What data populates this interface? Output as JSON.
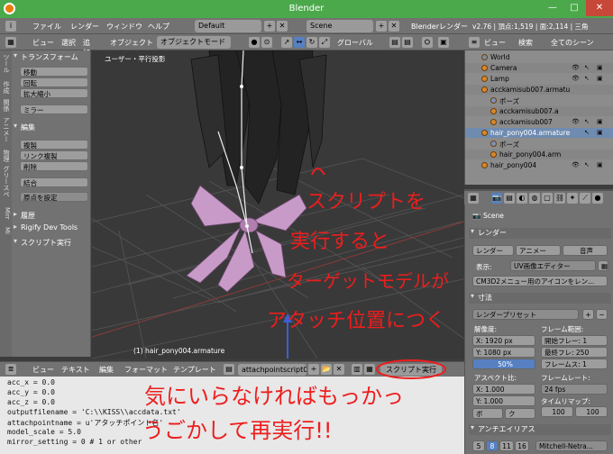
{
  "window": {
    "title": "Blender"
  },
  "topbar": {
    "menus": [
      "ファイル",
      "レンダー",
      "ウィンドウ",
      "ヘルプ"
    ],
    "layout": "Default",
    "scene": "Scene",
    "engine": "Blenderレンダー",
    "stats": "v2.76 | 頂点:1,519 | 面:2,114 | 三角"
  },
  "view3d_header": {
    "menus": [
      "ビュー",
      "選択",
      "追加",
      "オブジェクト"
    ],
    "mode": "オブジェクトモード",
    "orientation": "グローバル"
  },
  "toolshelf": {
    "tabs": [
      "ツール",
      "作成",
      "関係",
      "アニメー",
      "物理",
      "グリースペ",
      "Mirr",
      "Mi"
    ],
    "transform_header": "トランスフォーム",
    "transform_buttons": [
      "移動",
      "回転",
      "拡大縮小",
      "ミラー"
    ],
    "edit_header": "編集",
    "edit_buttons": [
      "複製",
      "リンク複製",
      "削除",
      "結合"
    ],
    "origin_label": "原点を設定",
    "history_header": "履歴",
    "rigify_header": "Rigify Dev Tools",
    "script_header": "スクリプト実行"
  },
  "viewport": {
    "label": "ユーザー・平行投影",
    "footer": "(1) hair_pony004.armature"
  },
  "outliner": {
    "menus": [
      "ビュー",
      "検索"
    ],
    "filter": "全てのシーン",
    "rows": [
      {
        "name": "World",
        "indent": 1
      },
      {
        "name": "Camera",
        "indent": 1
      },
      {
        "name": "Lamp",
        "indent": 1
      },
      {
        "name": "acckamisub007.armatu",
        "indent": 1
      },
      {
        "name": "ポーズ",
        "indent": 2
      },
      {
        "name": "acckamisub007.a",
        "indent": 2
      },
      {
        "name": "acckamisub007",
        "indent": 2
      },
      {
        "name": "hair_pony004.armature",
        "indent": 1
      },
      {
        "name": "ポーズ",
        "indent": 2
      },
      {
        "name": "hair_pony004.arm",
        "indent": 2
      },
      {
        "name": "hair_pony004",
        "indent": 2
      }
    ]
  },
  "properties": {
    "scene_label": "Scene",
    "render_header": "レンダー",
    "render_btn": "レンダー",
    "anim_btn": "アニメー",
    "audio_btn": "音声",
    "display_label": "表示:",
    "display_value": "UV画像エディター",
    "cm3d2_btn": "CM3D2メニュー用のアイコンをレン...",
    "dims_header": "寸法",
    "preset": "レンダープリセット",
    "resolution_label": "解像度:",
    "res_x": "X:  1920 px",
    "res_y": "Y:  1080 px",
    "res_pct": "50%",
    "frame_range_label": "フレーム範囲:",
    "frame_start": "開始フレー: 1",
    "frame_end": "最終フレ: 250",
    "frame_step": "フレームス: 1",
    "aspect_label": "アスペクト比:",
    "asp_x": "X:      1.000",
    "asp_y": "Y:      1.000",
    "framerate_label": "フレームレート:",
    "fps": "24 fps",
    "timemap_label": "タイムリマップ:",
    "timemap_old": "100",
    "timemap_new": "100",
    "border_label": "ボ",
    "crop_label": "ク",
    "aa_header": "アンチエイリアス",
    "aa_samples": [
      "5",
      "8",
      "11",
      "16"
    ],
    "aa_filter": "Mitchell-Netra..."
  },
  "text_editor": {
    "menus": [
      "ビュー",
      "テキスト",
      "編集",
      "フォーマット",
      "テンプレート"
    ],
    "filename": "attachpointscript01...",
    "run_button": "スクリプト実行",
    "lines": [
      "acc_x = 0.0",
      "acc_y = 0.0",
      "acc_z = 0.0",
      "outputfilename = 'C:\\\\KISS\\\\accdata.txt'",
      "attachpointname = u'アタッチポイント名'",
      "model_scale = 5.0",
      "mirror_setting = 0 # 1 or other"
    ]
  },
  "annotations": {
    "a1": "スクリプトを",
    "a2": "実行すると",
    "a3": "ターゲットモデルが",
    "a4": "アタッチ位置につく",
    "a5": "気にいらなければもっかっ",
    "a6": "うごかして再実行!!"
  },
  "colors": {
    "annotation": "#ee1d1d",
    "selection": "#5680c2",
    "titlebar": "#4ba94b"
  }
}
